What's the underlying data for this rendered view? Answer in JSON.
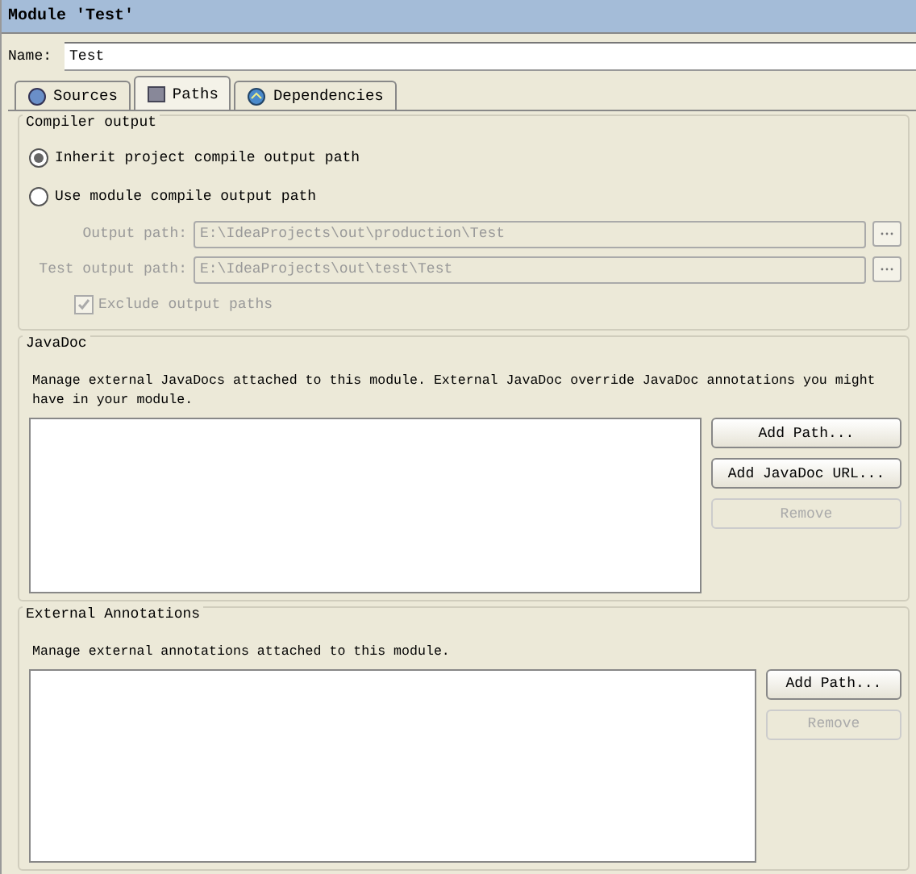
{
  "window": {
    "title": "Module 'Test'"
  },
  "name_field": {
    "label": "Name:",
    "value": "Test"
  },
  "tabs": [
    {
      "label": "Sources",
      "kind": "sources",
      "selected": false
    },
    {
      "label": "Paths",
      "kind": "paths",
      "selected": true
    },
    {
      "label": "Dependencies",
      "kind": "dependencies",
      "selected": false
    }
  ],
  "compiler_output": {
    "title": "Compiler output",
    "options": [
      {
        "label": "Inherit project compile output path",
        "selected": true
      },
      {
        "label": "Use module compile output path",
        "selected": false
      }
    ],
    "paths": [
      {
        "label": "Output path:",
        "value": "E:\\IdeaProjects\\out\\production\\Test",
        "disabled": true
      },
      {
        "label": "Test output path:",
        "value": "E:\\IdeaProjects\\out\\test\\Test",
        "disabled": true
      }
    ],
    "exclude": {
      "label": "Exclude output paths",
      "checked": true,
      "disabled": true
    }
  },
  "javadoc": {
    "title": "JavaDoc",
    "description": "Manage external JavaDocs attached to this module. External JavaDoc override JavaDoc annotations you might have in your module.",
    "buttons": [
      {
        "label": "Add Path...",
        "disabled": false
      },
      {
        "label": "Add JavaDoc URL...",
        "disabled": false
      },
      {
        "label": "Remove",
        "disabled": true
      }
    ]
  },
  "external_annotations": {
    "title": "External Annotations",
    "description": "Manage external annotations attached to this module.",
    "buttons": [
      {
        "label": "Add Path...",
        "disabled": false
      },
      {
        "label": "Remove",
        "disabled": true
      }
    ]
  }
}
